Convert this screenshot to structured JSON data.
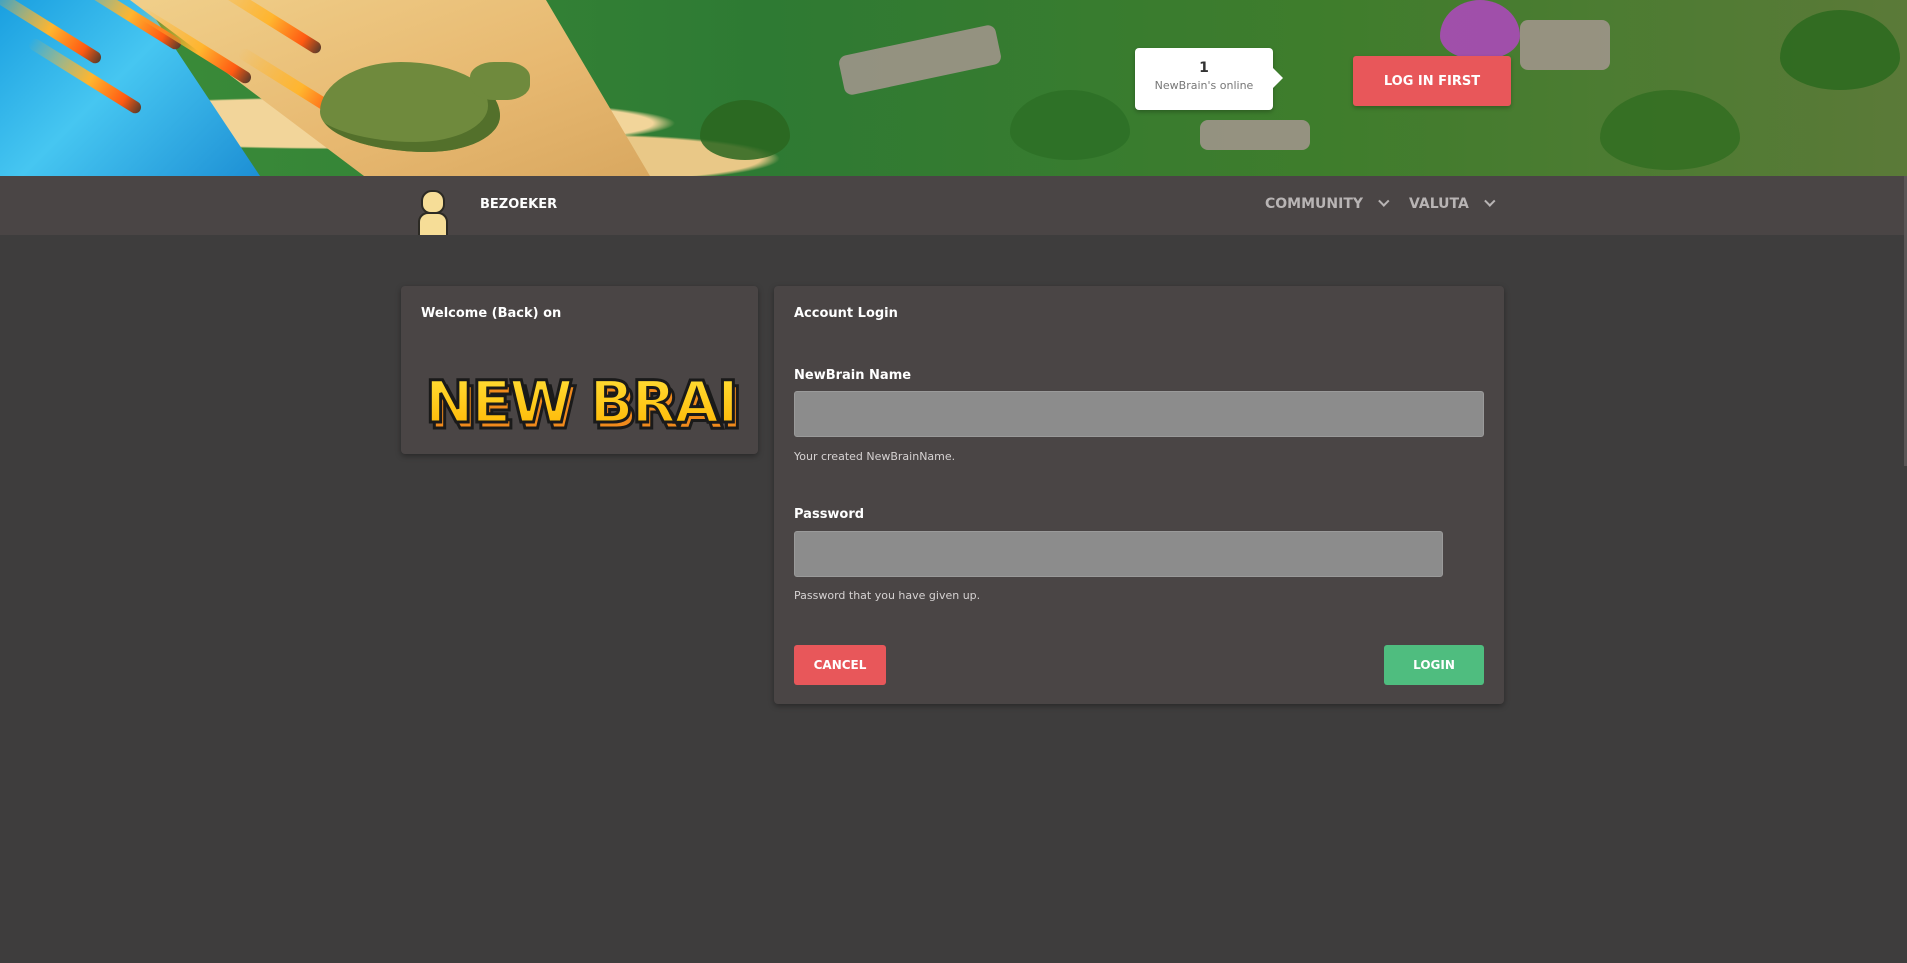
{
  "header": {
    "online_count": "1",
    "online_label": "NewBrain's online",
    "login_first_label": "LOG IN FIRST"
  },
  "nav": {
    "user_label": "BEZOEKER",
    "menus": [
      {
        "label": "COMMUNITY"
      },
      {
        "label": "VALUTA"
      }
    ]
  },
  "welcome": {
    "title": "Welcome (Back) on",
    "logo_text": "NEW BRAIN"
  },
  "login": {
    "title": "Account Login",
    "name_label": "NewBrain Name",
    "name_value": "",
    "name_help": "Your created NewBrainName.",
    "password_label": "Password",
    "password_value": "",
    "password_help": "Password that you have given up.",
    "cancel_label": "CANCEL",
    "login_label": "LOGIN"
  },
  "colors": {
    "page_bg": "#3e3d3d",
    "panel_bg": "#4a4545",
    "accent_red": "#e8575a",
    "accent_green": "#4fbd7f",
    "logo_yellow": "#ffd21a",
    "logo_orange": "#f08a1c"
  },
  "icons": [
    "avatar-icon",
    "chevron-down-icon"
  ]
}
